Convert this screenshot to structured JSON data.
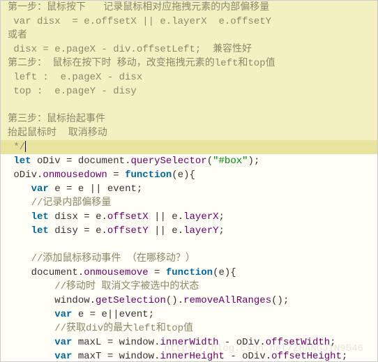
{
  "comment": {
    "l1": "第一步：鼠标按下   记录鼠标相对应拖拽元素的内部偏移量",
    "l2": " var disx  = e.offsetX || e.layerX  e.offsetY",
    "l3": "或者",
    "l4": " disx = e.pageX - div.offsetLeft;  兼容性好",
    "l5": "第二步： 鼠标在按下时 移动，改变拖拽元素的left和top值",
    "l6": " left :  e.pageX - disx",
    "l7": " top :  e.pageY - disy",
    "l8": "",
    "l9": "第三步：鼠标抬起事件",
    "l10": "抬起鼠标时  取消移动",
    "l11": " */"
  },
  "code": {
    "let": "let",
    "var": "var",
    "function": "function",
    "oDiv": "oDiv",
    "eq": " = ",
    "document": "document",
    "querySelector": "querySelector",
    "boxStr": "\"#box\"",
    "onmousedown": "onmousedown",
    "onmousemove": "onmousemove",
    "e_param": "(e){",
    "vare": "e",
    "event": "event",
    "or": " || ",
    "semi": ";",
    "cmt_record": "//记录内部偏移量",
    "disx": "disx",
    "disy": "disy",
    "offsetX": "offsetX",
    "offsetY": "offsetY",
    "layerX": "layerX",
    "layerY": "layerY",
    "cmt_addmove": "//添加鼠标移动事件 （在哪移动？）",
    "cmt_cancelsel": "//移动时 取消文字被选中的状态",
    "window": "window",
    "getSelection": "getSelection",
    "removeAllRanges": "removeAllRanges",
    "cmt_getmax": "//获取div的最大left和top值",
    "maxL": "maxL",
    "maxT": "maxT",
    "innerWidth": "innerWidth",
    "innerHeight": "innerHeight",
    "offsetWidth": "offsetWidth",
    "offsetHeight": "offsetHeight",
    "minus": " - ",
    "dot": ".",
    "lp": "(",
    "rp": ")",
    "lpp": "()",
    "oreq": "||"
  },
  "watermark": "https://blog.csdn.net/ZHANGJIN9546"
}
